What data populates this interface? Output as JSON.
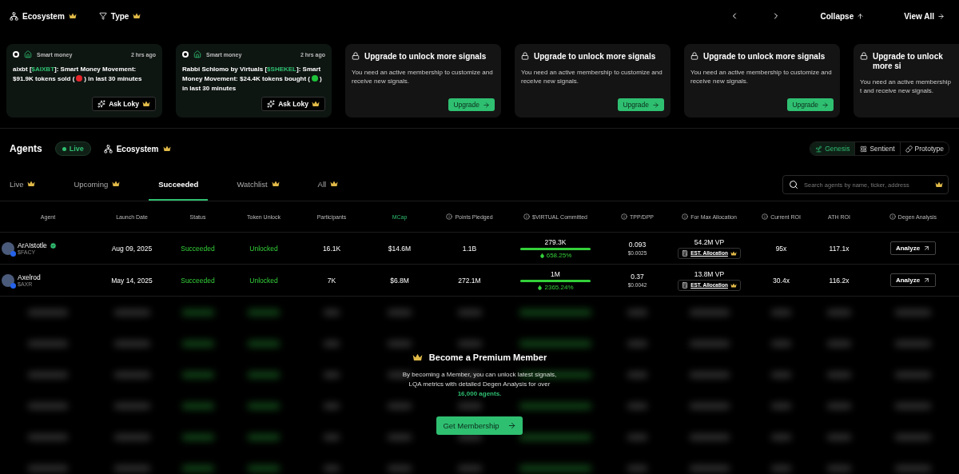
{
  "filters": [
    {
      "kind": "ecosystem",
      "label": "Ecosystem",
      "premium": true
    },
    {
      "kind": "type",
      "label": "Type",
      "premium": true
    }
  ],
  "nav": {
    "collapse": "Collapse",
    "view_all": "View All"
  },
  "signals": [
    {
      "kind": "signal",
      "category": "Smart money",
      "time": "2 hrs ago",
      "parts": [
        {
          "kind": "text",
          "text": "aixbt ["
        },
        {
          "kind": "ticker",
          "text": "$AIXBT"
        },
        {
          "kind": "text",
          "text": "]: Smart Money Movement: $91.9K tokens sold ("
        },
        {
          "kind": "dot",
          "color": "#e5262b"
        },
        {
          "kind": "text",
          "text": ") in last 30 minutes"
        }
      ],
      "button": "Ask Loky",
      "premium": true
    },
    {
      "kind": "signal",
      "category": "Smart money",
      "time": "2 hrs ago",
      "parts": [
        {
          "kind": "text",
          "text": "Rabbi Schlomo by Virtuals ["
        },
        {
          "kind": "ticker",
          "text": "$SHEKEL"
        },
        {
          "kind": "text",
          "text": "]: Smart Money Movement: $24.4K tokens bought ("
        },
        {
          "kind": "dot",
          "color": "#1fc23a"
        },
        {
          "kind": "text",
          "text": ") in last 30 minutes"
        }
      ],
      "button": "Ask Loky",
      "premium": true
    },
    {
      "kind": "locked",
      "title": "Upgrade to unlock more signals",
      "text": "You need an active membership to customize and receive new signals.",
      "button": "Upgrade"
    },
    {
      "kind": "locked",
      "title": "Upgrade to unlock more signals",
      "text": "You need an active membership to customize and receive new signals.",
      "button": "Upgrade"
    },
    {
      "kind": "locked",
      "title": "Upgrade to unlock more signals",
      "text": "You need an active membership to customize and receive new signals.",
      "button": "Upgrade"
    },
    {
      "kind": "locked",
      "title": "Upgrade to unlock more si",
      "text": "You need an active membership t and receive new signals."
    }
  ],
  "agents": {
    "title": "Agents",
    "live_badge": "Live",
    "ecosystem": {
      "label": "Ecosystem",
      "premium": true
    },
    "types": [
      {
        "kind": "genesis",
        "label": "Genesis",
        "selected": true
      },
      {
        "kind": "sentient",
        "label": "Sentient",
        "selected": false
      },
      {
        "kind": "prototype",
        "label": "Prototype",
        "selected": false
      }
    ],
    "tabs": [
      {
        "label": "Live",
        "premium": true,
        "selected": false
      },
      {
        "label": "Upcoming",
        "premium": true,
        "selected": false
      },
      {
        "label": "Succeeded",
        "premium": false,
        "selected": true
      },
      {
        "label": "Watchlist",
        "premium": true,
        "selected": false
      },
      {
        "label": "All",
        "premium": true,
        "selected": false
      }
    ],
    "search": {
      "placeholder": "Search agents by name, ticker, address",
      "premium": true
    }
  },
  "table": {
    "columns": [
      {
        "label": "Agent",
        "info": false,
        "selected": false
      },
      {
        "label": "Launch Date",
        "info": false,
        "selected": false
      },
      {
        "label": "Status",
        "info": false,
        "selected": false
      },
      {
        "label": "Token Unlock",
        "info": false,
        "selected": false
      },
      {
        "label": "Participants",
        "info": false,
        "selected": false
      },
      {
        "label": "MCap",
        "info": false,
        "selected": true
      },
      {
        "label": "Points Pledged",
        "info": true,
        "selected": false
      },
      {
        "label": "$VIRTUAL Committed",
        "info": true,
        "selected": false
      },
      {
        "label": "TPP/DPP",
        "info": true,
        "selected": false
      },
      {
        "label": "For Max Allocation",
        "info": true,
        "selected": false
      },
      {
        "label": "Current ROI",
        "info": true,
        "selected": false
      },
      {
        "label": "ATH ROI",
        "info": false,
        "selected": false
      },
      {
        "label": "Degen Analysis",
        "info": true,
        "selected": false
      }
    ],
    "rows": [
      {
        "name": "ArAIstotle",
        "verified": true,
        "ticker": "$FACY",
        "launch_date": "Aug 09, 2025",
        "status": "Succeeded",
        "token_unlock": "Unlocked",
        "participants": "16.1K",
        "mcap": "$14.6M",
        "points": "1.1B",
        "committed": "279.3K",
        "level": 1,
        "change": "658.25%",
        "tpp": "0.093",
        "dpp": "$0.0025",
        "allocation": "54.2M VP",
        "allocation_button": "EST. Allocation",
        "current_roi": "95x",
        "ath_roi": "117.1x",
        "action": "Analyze"
      },
      {
        "name": "Axelrod",
        "verified": false,
        "ticker": "$AXR",
        "launch_date": "May 14, 2025",
        "status": "Succeeded",
        "token_unlock": "Unlocked",
        "participants": "7K",
        "mcap": "$6.8M",
        "points": "272.1M",
        "committed": "1M",
        "level": 1,
        "change": "2365.24%",
        "tpp": "0.37",
        "dpp": "$0.0042",
        "allocation": "13.8M VP",
        "allocation_button": "EST. Allocation",
        "current_roi": "30.4x",
        "ath_roi": "116.2x",
        "action": "Analyze"
      }
    ]
  },
  "premium": {
    "title": "Become a Premium Member",
    "text": "By becoming a Member, you can unlock latest signals, LQA metrics with detailed Degen Analysis for over",
    "highlight": "16,000 agents.",
    "button": "Get Membership"
  }
}
